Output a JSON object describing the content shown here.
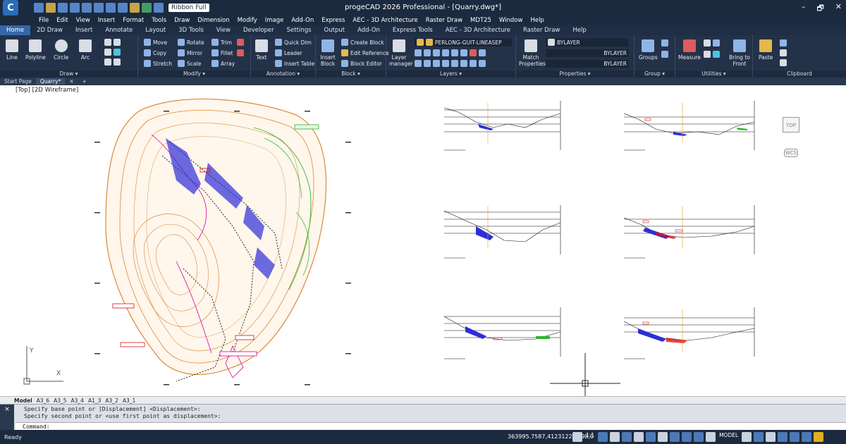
{
  "app": {
    "title": "progeCAD 2026 Professional - [Quarry.dwg*]",
    "ribbon_mode": "Ribbon Full",
    "window_controls": [
      "–",
      "🗗",
      "✕"
    ]
  },
  "menu": [
    "File",
    "Edit",
    "View",
    "Insert",
    "Format",
    "Tools",
    "Draw",
    "Dimension",
    "Modify",
    "Image",
    "Add-On",
    "Express",
    "AEC - 3D Architecture",
    "Raster Draw",
    "MDT25",
    "Window",
    "Help"
  ],
  "ribbon_tabs": [
    "Home",
    "2D Draw",
    "Insert",
    "Annotate",
    "Layout",
    "3D Tools",
    "View",
    "Developer",
    "Settings",
    "Output",
    "Add-On",
    "Express Tools",
    "AEC - 3D Architecture",
    "Raster Draw",
    "Help"
  ],
  "panels": {
    "draw": {
      "label": "Draw ▾",
      "tools": [
        "Line",
        "Polyline",
        "Circle",
        "Arc"
      ]
    },
    "modify": {
      "label": "Modify ▾",
      "tools": [
        "Move",
        "Rotate",
        "Trim",
        "Copy",
        "Mirror",
        "Fillet",
        "Stretch",
        "Scale",
        "Array"
      ]
    },
    "annotation": {
      "label": "Annotation ▾",
      "tools": [
        "Text",
        "Quick Dim",
        "Leader",
        "Insert Table"
      ]
    },
    "block": {
      "label": "Block ▾",
      "tools": [
        "Insert Block",
        "Create Block",
        "Edit Reference",
        "Block Editor"
      ]
    },
    "layers": {
      "label": "Layers ▾",
      "tool": "Layer manager",
      "current_layer": "PERLONG-GUIT-LINEASEP"
    },
    "properties": {
      "label": "Properties ▾",
      "tool": "Match Properties",
      "color": "BYLAYER",
      "linetype": "BYLAYER",
      "lineweight": "BYLAYER"
    },
    "group": {
      "label": "Group ▾",
      "tool": "Groups"
    },
    "utilities": {
      "label": "Utilities ▾",
      "tools": [
        "Measure",
        "Bring to Front"
      ]
    },
    "clipboard": {
      "label": "Clipboard",
      "tool": "Paste"
    }
  },
  "file_tabs": [
    "Start Page",
    "Quarry*"
  ],
  "viewport": {
    "label": "[Top] [2D Wireframe]",
    "nav_top": "TOP",
    "nav_wcs": "WCS",
    "ucs_y": "Y",
    "ucs_x": "X"
  },
  "layout_tabs": [
    "Model",
    "A3_6",
    "A3_5",
    "A3_4",
    "A1_3",
    "A3_2",
    "A3_1"
  ],
  "command": {
    "history": [
      "Specify base point or [Displacement] <Displacement>:",
      "Specify second point or <use first point as displacement>:"
    ],
    "prompt": "Command:"
  },
  "status": {
    "ready": "Ready",
    "coords": "363995.7587,4123122.1298,0",
    "scale": "1:1",
    "model": "MODEL"
  },
  "colors": {
    "title_bg": "#1b2a3e",
    "ribbon_bg": "#243249",
    "accent": "#3567a8",
    "contour": "#d98a3a",
    "water": "#2d2ed8",
    "green": "#2bb52b"
  }
}
